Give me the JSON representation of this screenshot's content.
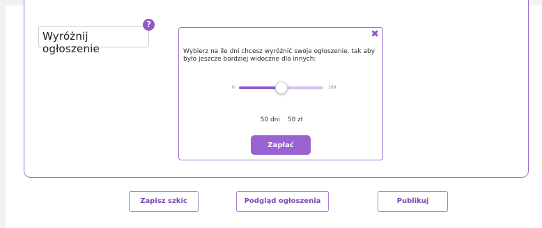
{
  "feature": {
    "label": "Wyróżnij ogłoszenie",
    "help_icon": "question-circle-icon"
  },
  "popup": {
    "close_icon": "close-x-icon",
    "description": "Wybierz na ile dni chcesz wyróżnić swoje ogłoszenie, tak aby było jeszcze bardziej widoczne dla innych:",
    "slider": {
      "min_label": "0",
      "max_label": "100",
      "min": 0,
      "max": 100,
      "value": 50
    },
    "days_text": "50 dni",
    "price_text": "50 zł",
    "pay_label": "Zapłać"
  },
  "actions": {
    "draft_label": "Zapisz szkic",
    "preview_label": "Podgląd ogłoszenia",
    "publish_label": "Publikuj"
  },
  "colors": {
    "accent": "#8e59c6",
    "border": "#9b6fd0",
    "track": "#d4c0ee"
  }
}
